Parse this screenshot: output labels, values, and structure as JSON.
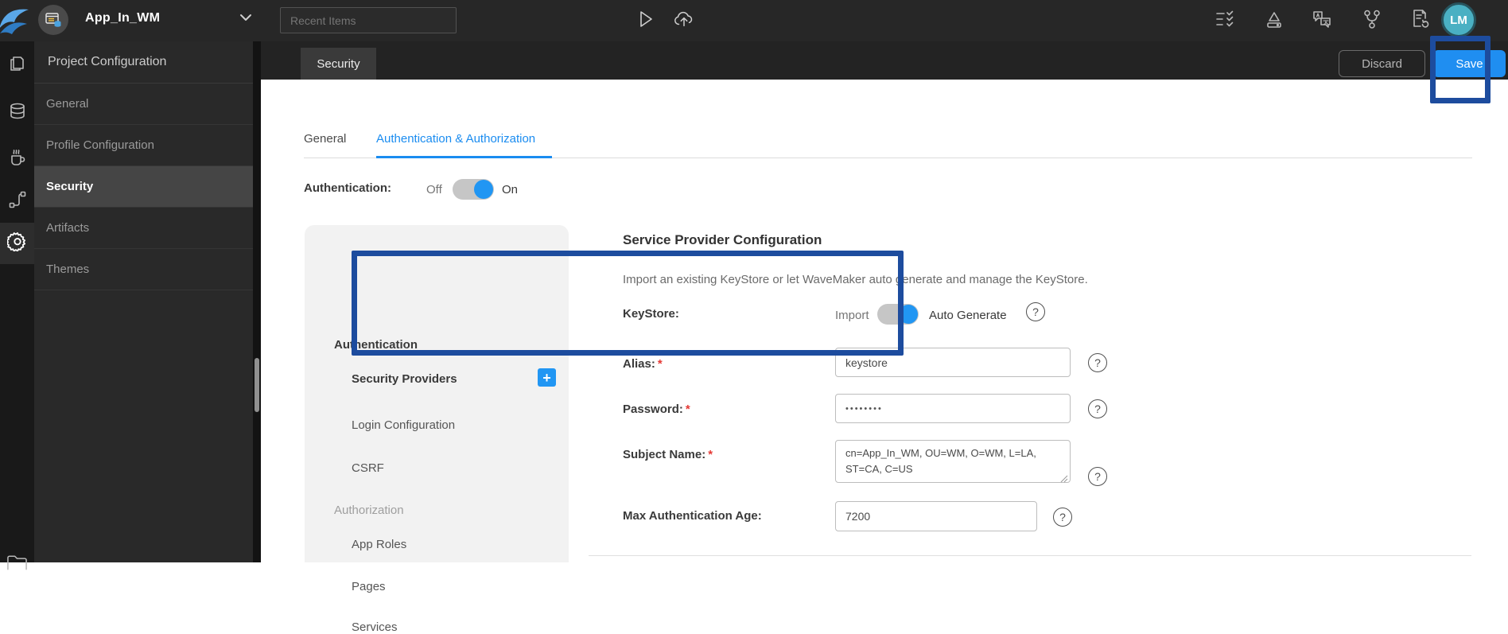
{
  "topbar": {
    "app_name": "App_In_WM",
    "search_placeholder": "Recent Items",
    "avatar_initials": "LM"
  },
  "docbar": {
    "tab_label": "Security",
    "discard_label": "Discard",
    "save_label": "Save"
  },
  "sidebar": {
    "title": "Project Configuration",
    "items": [
      {
        "label": "General",
        "selected": false
      },
      {
        "label": "Profile Configuration",
        "selected": false
      },
      {
        "label": "Security",
        "selected": true
      },
      {
        "label": "Artifacts",
        "selected": false
      },
      {
        "label": "Themes",
        "selected": false
      }
    ]
  },
  "tabs": {
    "items": [
      {
        "label": "General",
        "active": false
      },
      {
        "label": "Authentication & Authorization",
        "active": true
      }
    ]
  },
  "auth_row": {
    "label": "Authentication:",
    "off_label": "Off",
    "on_label": "On",
    "state": "On"
  },
  "security_nav": {
    "sections": [
      {
        "header": "Authentication",
        "items": [
          "Security Providers",
          "Login Configuration",
          "CSRF"
        ],
        "selected_item": "Security Providers"
      },
      {
        "header": "Authorization",
        "items": [
          "App Roles",
          "Pages",
          "Services"
        ]
      }
    ]
  },
  "sp": {
    "title": "Service Provider Configuration",
    "description": "Import an existing KeyStore or let WaveMaker auto generate and manage the KeyStore.",
    "keystore": {
      "label": "KeyStore:",
      "off_label": "Import",
      "on_label": "Auto Generate",
      "state": "Auto Generate"
    },
    "fields": [
      {
        "label": "Alias:",
        "required": true,
        "value": "keystore"
      },
      {
        "label": "Password:",
        "required": true,
        "value": "••••••••"
      },
      {
        "label": "Subject Name:",
        "required": true,
        "value": "cn=App_In_WM, OU=WM, O=WM, L=LA, ST=CA, C=US"
      },
      {
        "label": "Max Authentication Age:",
        "required": false,
        "value": "7200"
      }
    ]
  },
  "glyphs": {
    "required": "*",
    "help": "?",
    "plus": "+"
  },
  "colors": {
    "accent_blue": "#1a8cf0",
    "toggle_blue": "#2196f3",
    "save_blue": "#1f8ef1",
    "annotation_navy": "#1d4c9e",
    "avatar_teal": "#4ab0c3",
    "required_red": "#e53935"
  }
}
